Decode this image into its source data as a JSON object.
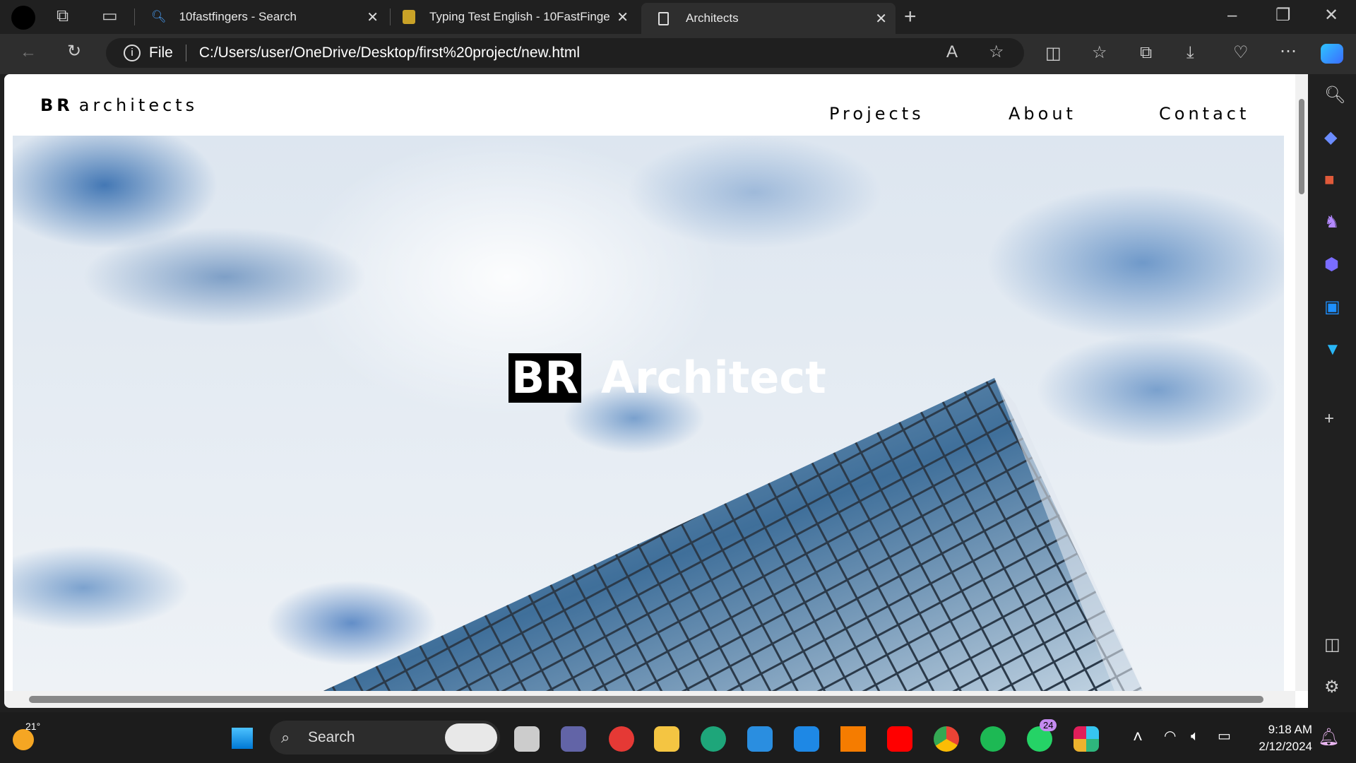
{
  "browser": {
    "tabs": [
      {
        "label": "10fastfingers - Search",
        "icon": "search-icon"
      },
      {
        "label": "Typing Test English - 10FastFinge",
        "icon": "10fastfingers-favicon"
      },
      {
        "label": "Architects",
        "icon": "page-icon",
        "active": true
      }
    ],
    "address": {
      "scheme": "File",
      "url": "C:/Users/user/OneDrive/Desktop/first%20project/new.html"
    }
  },
  "site": {
    "logo_bold": "BR",
    "logo_text": "architects",
    "nav": [
      "Projects",
      "About",
      "Contact"
    ],
    "hero_badge": "BR",
    "hero_title": "Architect"
  },
  "taskbar": {
    "weather": "21°",
    "search_placeholder": "Search",
    "whatsapp_badge": "24",
    "time": "9:18 AM",
    "date": "2/12/2024"
  }
}
